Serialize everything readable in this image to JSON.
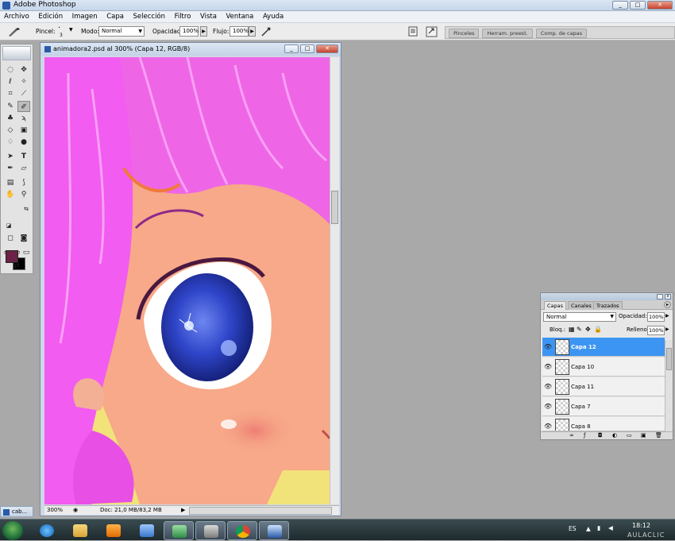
{
  "app": {
    "title": "Adobe Photoshop"
  },
  "window_buttons": {
    "minimize": "_",
    "maximize": "□",
    "close": "✕"
  },
  "menu": [
    "Archivo",
    "Edición",
    "Imagen",
    "Capa",
    "Selección",
    "Filtro",
    "Vista",
    "Ventana",
    "Ayuda"
  ],
  "options": {
    "brush_label": "Pincel:",
    "brush_size": "3",
    "mode_label": "Modo:",
    "mode_value": "Normal",
    "opacity_label": "Opacidad:",
    "opacity_value": "100%",
    "flow_label": "Flujo:",
    "flow_value": "100%"
  },
  "panel_well_tabs": [
    "Pinceles",
    "Herram. preest.",
    "Comp. de capas"
  ],
  "document": {
    "title": "animadora2.psd al 300% (Capa 12, RGB/8)",
    "zoom": "300%",
    "doc_info": "Doc: 21,0 MB/83,2 MB"
  },
  "layers_panel": {
    "tabs": [
      "Capas",
      "Canales",
      "Trazados"
    ],
    "blend_mode": "Normal",
    "opacity_label": "Opacidad:",
    "opacity_value": "100%",
    "lock_label": "Bloq.:",
    "fill_label": "Relleno:",
    "fill_value": "100%",
    "layers": [
      {
        "name": "Capa 12",
        "active": true
      },
      {
        "name": "Capa 10",
        "active": false
      },
      {
        "name": "Capa 11",
        "active": false
      },
      {
        "name": "Capa 7",
        "active": false
      },
      {
        "name": "Capa 8",
        "active": false
      }
    ]
  },
  "minimized_app": {
    "label": "cab..."
  },
  "taskbar": {
    "language": "ES",
    "time": "18:12",
    "watermark": "AULACLIC"
  },
  "colors": {
    "foreground": "#6b2246",
    "background": "#000000",
    "active_layer": "#3d95f3",
    "hair_pink": "#f25cf0",
    "skin": "#f7a989",
    "iris": "#2f45c9"
  }
}
